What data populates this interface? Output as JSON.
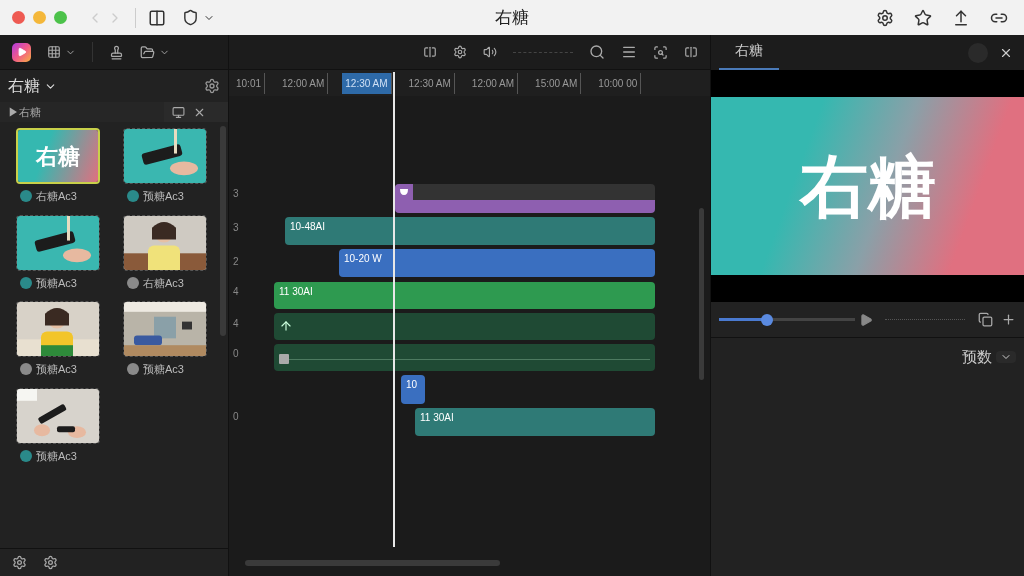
{
  "window": {
    "title": "右糖"
  },
  "library": {
    "title": "右糖",
    "folder": "▶右糖",
    "items": [
      {
        "kind": "title",
        "thumb_text": "右糖",
        "label": "右糖Ac3",
        "color": "#2a8a8a",
        "selected": true
      },
      {
        "kind": "clip",
        "label": "预糖Ac3",
        "color": "#2a8a8a",
        "selected": false
      },
      {
        "kind": "clip",
        "label": "预糖Ac3",
        "color": "#2a8a8a",
        "selected": false
      },
      {
        "kind": "clip",
        "label": "右糖Ac3",
        "color": "#8a8a8a",
        "selected": false
      },
      {
        "kind": "clip",
        "label": "预糖Ac3",
        "color": "#8a8a8a",
        "selected": false
      },
      {
        "kind": "clip",
        "label": "预糖Ac3",
        "color": "#8a8a8a",
        "selected": false
      },
      {
        "kind": "clip",
        "label": "预糖Ac3",
        "color": "#2a8a8a",
        "selected": false
      }
    ]
  },
  "timeline": {
    "ruler": [
      {
        "label": "10:01",
        "selected": false
      },
      {
        "label": "12:00 AM",
        "selected": false
      },
      {
        "label": "12:30 AM",
        "selected": true
      },
      {
        "label": "12:30 AM",
        "selected": false
      },
      {
        "label": "12:00 AM",
        "selected": false
      },
      {
        "label": "15:00 AM",
        "selected": false
      },
      {
        "label": "10:00 00",
        "selected": false
      }
    ],
    "track_numbers": [
      "3",
      "3",
      "2",
      "4",
      "4",
      "0",
      "0"
    ],
    "clips": [
      {
        "kind": "title",
        "color": "#8e5fb0"
      },
      {
        "kind": "video",
        "label": "10-48AI",
        "color": "#2f7a76"
      },
      {
        "kind": "video",
        "label": "10-20 W",
        "color": "#3a6fc0"
      },
      {
        "kind": "video",
        "label": "11 30AI",
        "color": "#2e9a50"
      },
      {
        "kind": "effect",
        "color": "#1f4a34"
      },
      {
        "kind": "audio",
        "color": "#1f4a34"
      },
      {
        "kind": "video",
        "label": "10",
        "color": "#3a6fc0"
      },
      {
        "kind": "video",
        "label": "11 30AI",
        "color": "#2f7a76"
      }
    ]
  },
  "preview": {
    "tab": "右糖",
    "title": "右糖",
    "level": 0.35,
    "dropdown": "预数"
  }
}
